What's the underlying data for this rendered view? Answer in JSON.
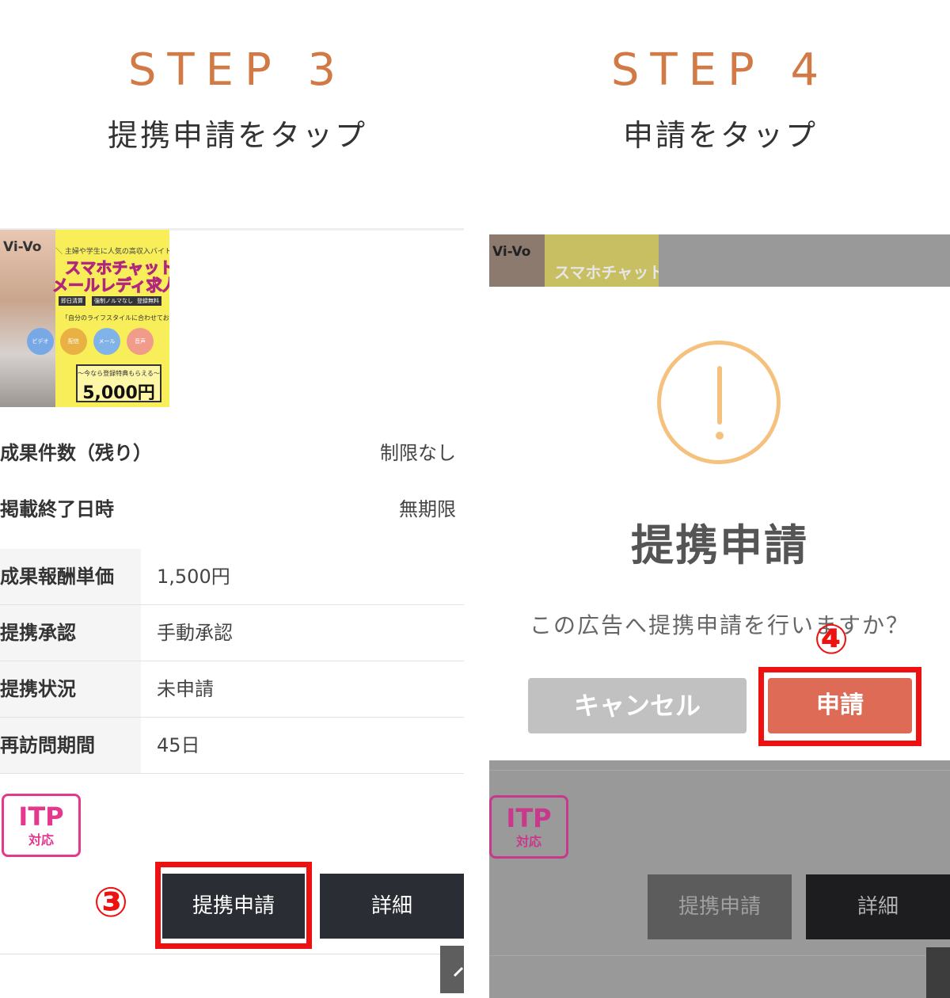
{
  "steps": [
    {
      "label": "STEP 3",
      "subtitle": "提携申請をタップ"
    },
    {
      "label": "STEP 4",
      "subtitle": "申請をタップ"
    }
  ],
  "banner": {
    "logo": "Vi-Vo",
    "tagline": "＼ 主婦や学生に人気の高収入バイト ／",
    "headline1": "スマホチャット",
    "headline2": "メールレディ求人",
    "pills": [
      "即日清算",
      "強制ノルマなし",
      "登録無料"
    ],
    "desc": "「自分のライフスタイルに合わせてお仕事できる」",
    "circles": [
      "ビデオ",
      "配信",
      "メール",
      "音声"
    ],
    "bonus_line": "〜今なら登録特典もらえる〜",
    "bonus_amount": "5,000円"
  },
  "left": {
    "info": [
      {
        "label": "成果件数（残り）",
        "value": "制限なし"
      },
      {
        "label": "掲載終了日時",
        "value": "無期限"
      }
    ],
    "table": [
      {
        "label": "成果報酬単価",
        "value": "1,500円"
      },
      {
        "label": "提携承認",
        "value": "手動承認"
      },
      {
        "label": "提携状況",
        "value": "未申請"
      },
      {
        "label": "再訪問期間",
        "value": "45日"
      }
    ],
    "itp_big": "ITP",
    "itp_small": "対応",
    "apply_button": "提携申請",
    "detail_button": "詳細",
    "marker": "③"
  },
  "right": {
    "modal_title": "提携申請",
    "modal_message": "この広告へ提携申請を行いますか？",
    "cancel_button": "キャンセル",
    "apply_button": "申請",
    "marker": "④",
    "bg_apply_button": "提携申請",
    "bg_detail_button": "詳細",
    "itp_big": "ITP",
    "itp_small": "対応"
  },
  "colors": {
    "step_accent": "#d27a45",
    "highlight_red": "#ee1111",
    "apply_red": "#dd6b55",
    "warn_orange": "#f6c17e",
    "itp_pink": "#e4378d"
  }
}
